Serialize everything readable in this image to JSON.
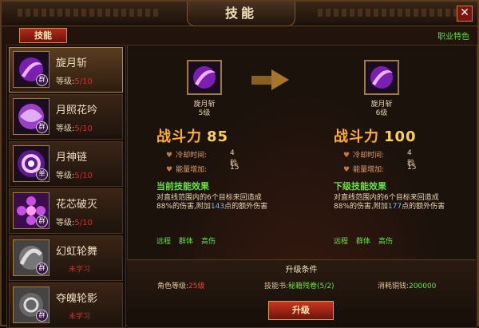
{
  "window": {
    "title": "技能",
    "close": "✕"
  },
  "tabs": {
    "skills": "技能",
    "career": "职业特色"
  },
  "skill_list": [
    {
      "name": "旋月斩",
      "level_label": "等级:",
      "level_value": "5/10",
      "tag": "群",
      "color": "#a02cd6"
    },
    {
      "name": "月照花吟",
      "level_label": "等级:",
      "level_value": "5/10",
      "tag": "群",
      "color": "#b84ad8"
    },
    {
      "name": "月神链",
      "level_label": "等级:",
      "level_value": "5/10",
      "tag": "单",
      "color": "#8f2ad0"
    },
    {
      "name": "花芯破灭",
      "level_label": "等级:",
      "level_value": "5/10",
      "tag": "群",
      "color": "#c048d6"
    },
    {
      "name": "幻虹轮舞",
      "locked_text": "未学习",
      "tag": "群",
      "color": "#888888"
    },
    {
      "name": "夺魄轮影",
      "locked_text": "未学习",
      "tag": "群",
      "color": "#888888"
    }
  ],
  "current": {
    "name": "旋月斩",
    "level": "5级",
    "power_label": "战斗力",
    "power": "85",
    "cooldown_label": "冷却时间:",
    "cooldown": "4秒",
    "energy_label": "能量增加:",
    "energy": "15",
    "effect_title": "当前技能效果",
    "effect_pre": "对直线范围内的6个目标来回造成88%的伤害,附加",
    "effect_hl": "143",
    "effect_post": "点的额外伤害",
    "tags": [
      "远程",
      "群体",
      "高伤"
    ]
  },
  "next": {
    "name": "旋月斩",
    "level": "6级",
    "power_label": "战斗力",
    "power": "100",
    "cooldown_label": "冷却时间:",
    "cooldown": "4秒",
    "energy_label": "能量增加:",
    "energy": "15",
    "effect_title": "下级技能效果",
    "effect_pre": "对直线范围内的6个目标来回造成88%的伤害,附加",
    "effect_hl": "177",
    "effect_post": "点的额外伤害",
    "tags": [
      "远程",
      "群体",
      "高伤"
    ]
  },
  "upgrade": {
    "title": "升级条件",
    "role_level_label": "角色等级:",
    "role_level": "25级",
    "book_label": "技能书:",
    "book": "秘籍残卷(5/2)",
    "cost_label": "消耗铜钱:",
    "cost": "200000",
    "button": "升级"
  }
}
